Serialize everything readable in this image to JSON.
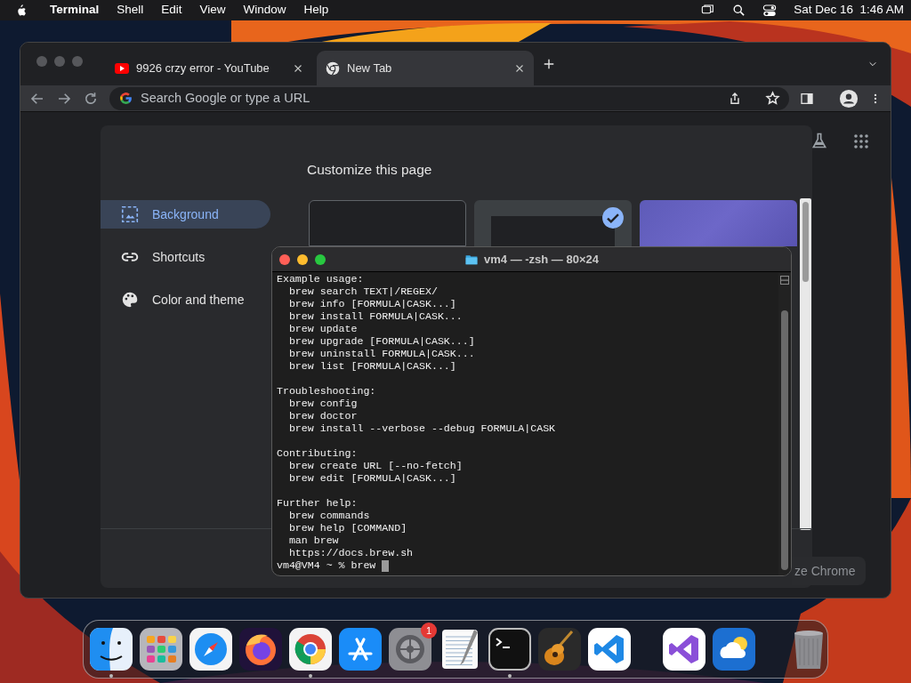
{
  "menu_bar": {
    "app": "Terminal",
    "menus": [
      "Shell",
      "Edit",
      "View",
      "Window",
      "Help"
    ],
    "clock": "Sat Dec 16  1:46 AM"
  },
  "browser": {
    "tabs": [
      {
        "title": "9926 crzy error - YouTube",
        "selected": false
      },
      {
        "title": "New Tab",
        "selected": true
      }
    ],
    "omnibox": {
      "placeholder": "Search Google or type a URL"
    },
    "customize_dialog": {
      "title": "Customize this page",
      "sidebar": [
        {
          "label": "Background",
          "selected": true
        },
        {
          "label": "Shortcuts",
          "selected": false
        },
        {
          "label": "Color and theme",
          "selected": false
        }
      ],
      "thumbnails": [
        {
          "kind": "blank",
          "selected": false
        },
        {
          "kind": "google",
          "selected": true
        },
        {
          "kind": "purple",
          "selected": false
        }
      ]
    },
    "customize_button": "ze Chrome"
  },
  "terminal": {
    "title": "vm4 — -zsh — 80×24",
    "sections": [
      {
        "heading": "Example usage:",
        "lines": [
          "brew search TEXT|/REGEX/",
          "brew info [FORMULA|CASK...]",
          "brew install FORMULA|CASK...",
          "brew update",
          "brew upgrade [FORMULA|CASK...]",
          "brew uninstall FORMULA|CASK...",
          "brew list [FORMULA|CASK...]"
        ]
      },
      {
        "heading": "Troubleshooting:",
        "lines": [
          "brew config",
          "brew doctor",
          "brew install --verbose --debug FORMULA|CASK"
        ]
      },
      {
        "heading": "Contributing:",
        "lines": [
          "brew create URL [--no-fetch]",
          "brew edit [FORMULA|CASK...]"
        ]
      },
      {
        "heading": "Further help:",
        "lines": [
          "brew commands",
          "brew help [COMMAND]",
          "man brew",
          "https://docs.brew.sh"
        ]
      }
    ],
    "prompt": "vm4@VM4 ~ % brew"
  },
  "dock": [
    {
      "kind": "finder",
      "running": true
    },
    {
      "kind": "launchpad",
      "running": false
    },
    {
      "kind": "safari",
      "running": false
    },
    {
      "kind": "firefox",
      "running": false
    },
    {
      "kind": "chrome",
      "running": true
    },
    {
      "kind": "appstore",
      "running": false
    },
    {
      "kind": "settings",
      "running": false,
      "badge": "1"
    },
    {
      "kind": "textedit",
      "running": false
    },
    {
      "kind": "terminal",
      "running": true
    },
    {
      "kind": "guitar",
      "running": false
    },
    {
      "kind": "vscode",
      "running": false
    },
    {
      "kind": "separator"
    },
    {
      "kind": "vs",
      "running": false
    },
    {
      "kind": "weather",
      "running": false
    },
    {
      "kind": "separator"
    },
    {
      "kind": "trash",
      "running": false
    }
  ]
}
